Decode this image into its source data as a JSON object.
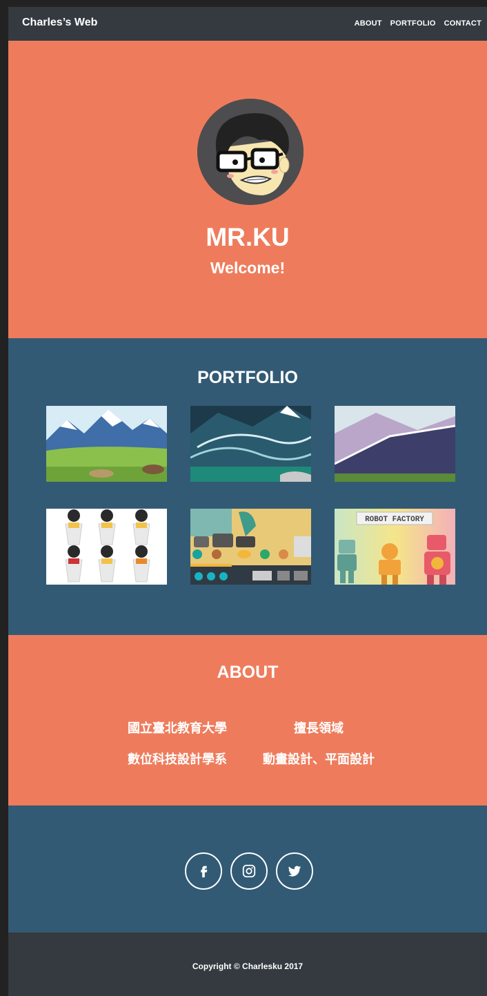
{
  "nav": {
    "brand": "Charles’s Web",
    "links": [
      "ABOUT",
      "PORTFOLIO",
      "CONTACT"
    ]
  },
  "hero": {
    "name": "MR.KU",
    "greeting": "Welcome!"
  },
  "portfolio": {
    "title": "PORTFOLIO",
    "items": [
      {
        "icon": "mountain-meadow-illustration"
      },
      {
        "icon": "dark-mountain-illustration"
      },
      {
        "icon": "purple-hills-illustration"
      },
      {
        "icon": "cartoon-characters-cups"
      },
      {
        "icon": "game-interface-illustration"
      },
      {
        "icon": "robot-factory-illustration",
        "caption": "ROBOT FACTORY"
      }
    ]
  },
  "about": {
    "title": "ABOUT",
    "left": [
      "國立臺北教育大學",
      "數位科技設計學系"
    ],
    "right": [
      "擅長領域",
      "動畫設計、平面設計"
    ]
  },
  "social": [
    {
      "icon": "facebook-icon"
    },
    {
      "icon": "instagram-icon"
    },
    {
      "icon": "twitter-icon"
    }
  ],
  "footer": {
    "copyright": "Copyright © Charlesku 2017"
  },
  "colors": {
    "accent": "#ee7c5c",
    "section_blue": "#325a74",
    "nav_dark": "#343a40"
  }
}
